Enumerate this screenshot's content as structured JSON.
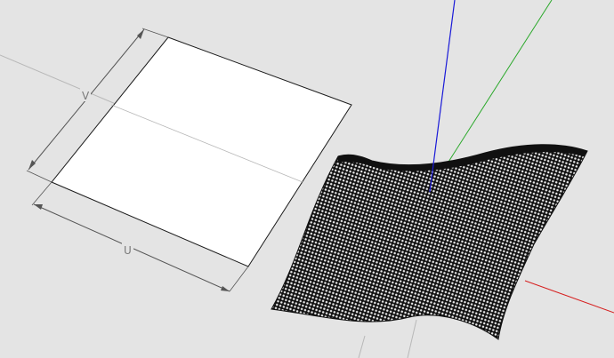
{
  "scene": {
    "background_color": "#e4e4e4",
    "axes": {
      "x_axis_color": "#d62020",
      "y_axis_color": "#2aa82a",
      "z_axis_color": "#1a1ad8",
      "inference_line_color": "#b8b8b8"
    },
    "flat_face": {
      "fill": "#ffffff",
      "edge_color": "#1c1c1c"
    },
    "dimensions": {
      "v_label": "V",
      "u_label": "U",
      "dimension_color": "#555555"
    },
    "surface": {
      "fill": "#101010",
      "mesh_color": "#e8e8e8"
    }
  }
}
